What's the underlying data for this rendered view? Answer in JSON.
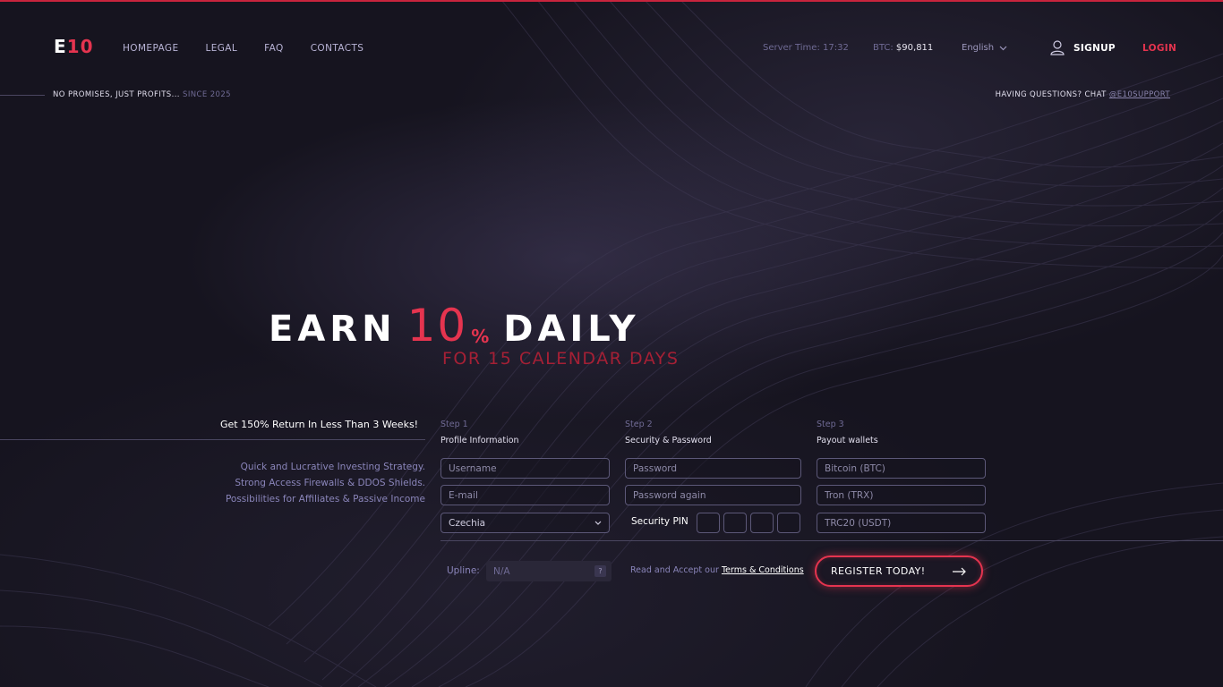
{
  "header": {
    "logo_e": "E",
    "logo_num": "10",
    "nav": [
      "HOMEPAGE",
      "LEGAL",
      "FAQ",
      "CONTACTS"
    ],
    "server_time_label": "Server Time:",
    "server_time": "17:32",
    "btc_label": "BTC:",
    "btc_value": "$90,811",
    "language": "English",
    "signup": "SIGNUP",
    "login": "LOGIN"
  },
  "subheader": {
    "slogan": "NO PROMISES, JUST PROFITS...",
    "since": "SINCE 2025",
    "help_text": "HAVING QUESTIONS? CHAT",
    "help_link": "@E10SUPPORT"
  },
  "hero": {
    "earn": "EARN",
    "number": "10",
    "percent": "%",
    "daily": "DAILY",
    "subtitle": "FOR 15 CALENDAR DAYS"
  },
  "left": {
    "title": "Get 150% Return In Less Than 3 Weeks!",
    "features": [
      "Quick and Lucrative Investing Strategy.",
      "Strong Access Firewalls & DDOS Shields.",
      "Possibilities for Affiliates & Passive Income"
    ]
  },
  "form": {
    "step1": {
      "step": "Step 1",
      "title": "Profile Information"
    },
    "step2": {
      "step": "Step 2",
      "title": "Security & Password"
    },
    "step3": {
      "step": "Step 3",
      "title": "Payout wallets"
    },
    "username_ph": "Username",
    "email_ph": "E-mail",
    "country": "Czechia",
    "password_ph": "Password",
    "password_again_ph": "Password again",
    "pin_label": "Security PIN",
    "btc_ph": "Bitcoin (BTC)",
    "trx_ph": "Tron (TRX)",
    "usdt_ph": "TRC20 (USDT)",
    "upline_label": "Upline:",
    "upline_value": "N/A",
    "upline_help": "?",
    "terms_text": "Read and Accept our",
    "terms_link": "Terms & Conditions",
    "register": "REGISTER TODAY!"
  },
  "colors": {
    "accent": "#e5344f",
    "background": "#16141f",
    "muted": "#8a85ba"
  },
  "icons": {
    "user": "user-icon",
    "chevron": "chevron-down-icon",
    "arrow": "arrow-right-icon"
  }
}
